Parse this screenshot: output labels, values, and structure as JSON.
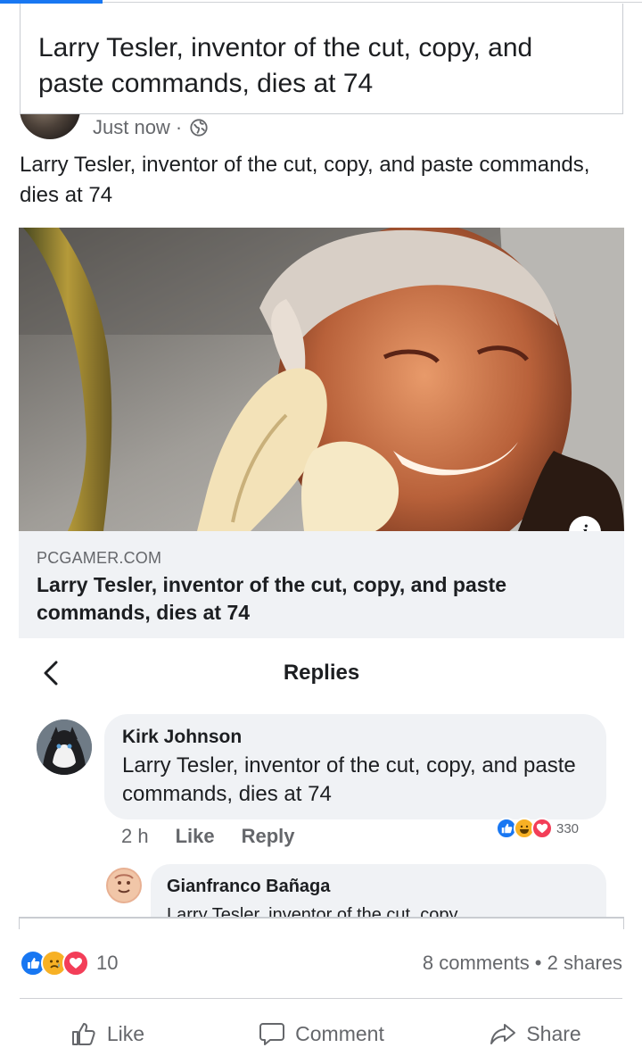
{
  "shared_quote": {
    "text": "Larry Tesler, inventor of the cut, copy, and paste commands, dies at 74"
  },
  "post": {
    "timestamp": "Just now ·",
    "privacy_icon": "globe-icon",
    "text": "Larry Tesler, inventor of the cut, copy, and paste commands, dies at 74"
  },
  "link_preview": {
    "domain": "PCGAMER.COM",
    "title": "Larry Tesler, inventor of the cut, copy, and paste commands, dies at 74",
    "info_icon": "i"
  },
  "replies": {
    "title": "Replies",
    "comments": [
      {
        "author": "Kirk Johnson",
        "text": "Larry Tesler, inventor of the cut, copy, and paste commands, dies at 74",
        "time": "2 h",
        "like_label": "Like",
        "reply_label": "Reply",
        "reaction_count": "330"
      },
      {
        "author": "Gianfranco Bañaga",
        "text": "Larry Tesler, inventor of the cut, copy"
      }
    ]
  },
  "footer": {
    "reaction_count": "10",
    "stats": "8 comments • 2 shares",
    "like_label": "Like",
    "comment_label": "Comment",
    "share_label": "Share"
  },
  "colors": {
    "accent": "#1877f2",
    "like_blue": "#1877f2",
    "love_red": "#f33e58",
    "haha_yellow": "#f7b125"
  }
}
